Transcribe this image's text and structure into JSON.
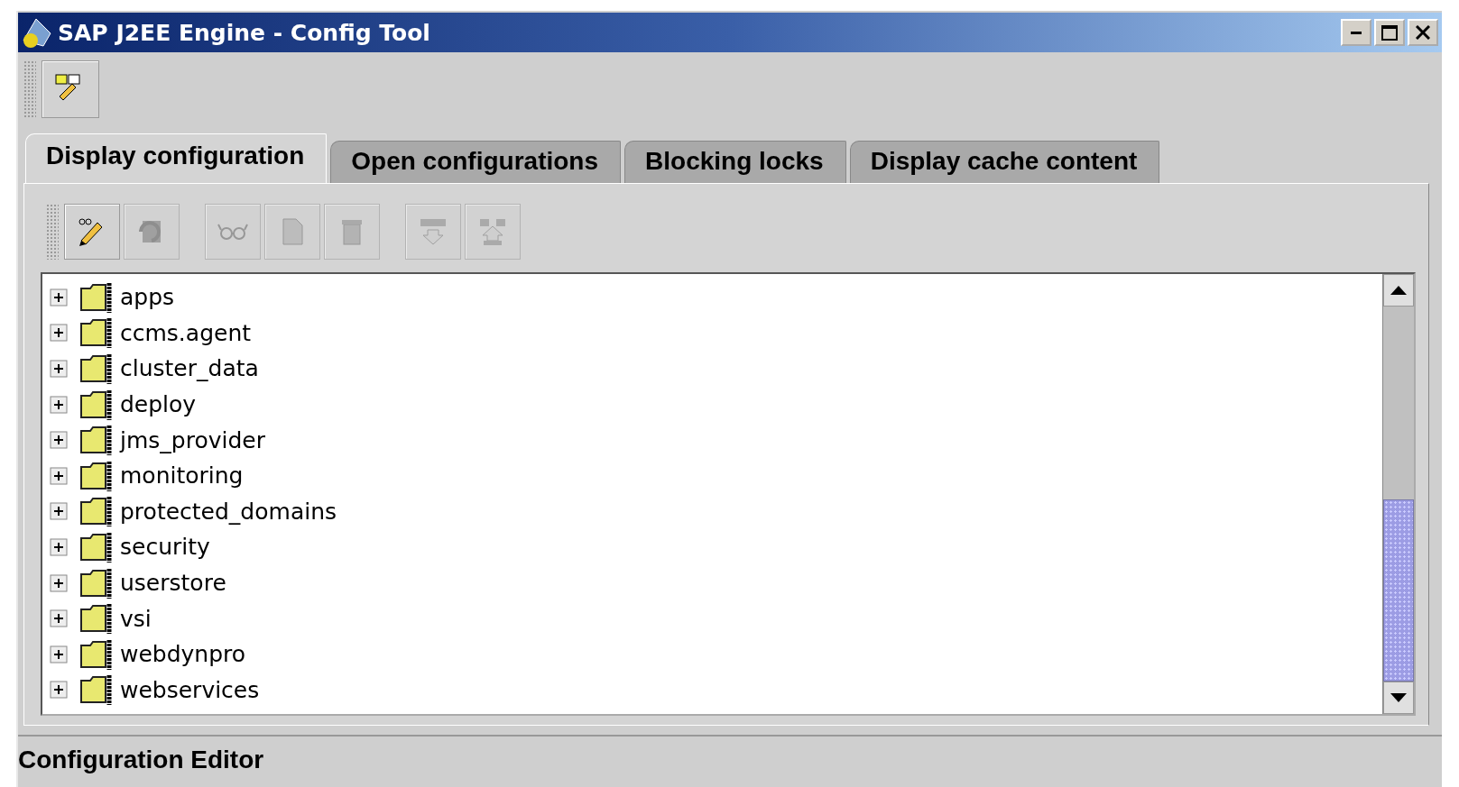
{
  "window": {
    "title": "SAP J2EE Engine - Config Tool"
  },
  "main_toolbar": {
    "buttons": [
      {
        "kind": "edit-panels",
        "disabled": false
      }
    ]
  },
  "tabs": [
    {
      "label": "Display configuration",
      "selected": true
    },
    {
      "label": "Open configurations",
      "selected": false
    },
    {
      "label": "Blocking locks",
      "selected": false
    },
    {
      "label": "Display cache content",
      "selected": false
    }
  ],
  "tab_toolbar": {
    "groups": [
      [
        {
          "kind": "edit",
          "disabled": false
        },
        {
          "kind": "refresh",
          "disabled": true
        }
      ],
      [
        {
          "kind": "view",
          "disabled": true
        },
        {
          "kind": "new",
          "disabled": true
        },
        {
          "kind": "delete",
          "disabled": true
        }
      ],
      [
        {
          "kind": "download",
          "disabled": true
        },
        {
          "kind": "upload",
          "disabled": true
        }
      ]
    ]
  },
  "tree": {
    "nodes": [
      {
        "label": "apps",
        "expanded": false
      },
      {
        "label": "ccms.agent",
        "expanded": false
      },
      {
        "label": "cluster_data",
        "expanded": false
      },
      {
        "label": "deploy",
        "expanded": false
      },
      {
        "label": "jms_provider",
        "expanded": false
      },
      {
        "label": "monitoring",
        "expanded": false
      },
      {
        "label": "protected_domains",
        "expanded": false
      },
      {
        "label": "security",
        "expanded": false
      },
      {
        "label": "userstore",
        "expanded": false
      },
      {
        "label": "vsi",
        "expanded": false
      },
      {
        "label": "webdynpro",
        "expanded": false
      },
      {
        "label": "webservices",
        "expanded": false
      }
    ]
  },
  "status_bar": {
    "text": "Configuration Editor"
  }
}
